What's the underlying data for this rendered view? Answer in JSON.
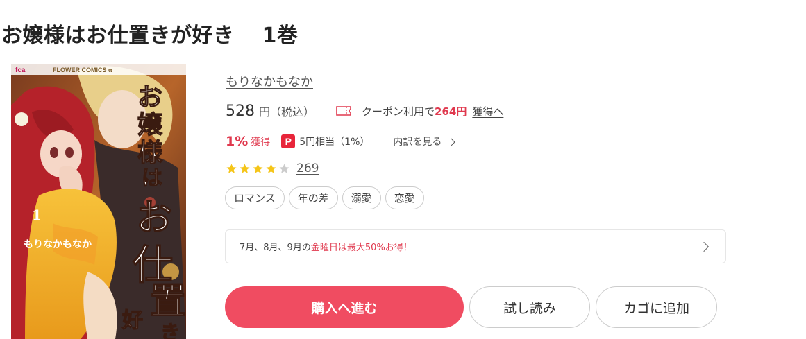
{
  "book": {
    "title": "お嬢様はお仕置きが好き",
    "volume": "1巻",
    "author": "もりなかもなか"
  },
  "cover": {
    "label_top": "FLOWER COMICS α",
    "label_logo": "fca",
    "title_art": "お嬢様はお仕置きが好き",
    "volume_mark": "1",
    "author_art": "もりなかもなか"
  },
  "price": {
    "amount": "528",
    "unit": "円",
    "tax_note": "（税込）",
    "coupon_prefix": "クーポン利用で",
    "coupon_amount": "264円",
    "coupon_link": "獲得へ"
  },
  "points": {
    "percent": "1%",
    "earn_label": "獲得",
    "paypay_icon": "P",
    "equivalent": "5円相当（1%）",
    "breakdown_link": "内訳を見る"
  },
  "rating": {
    "stars": 4,
    "max_stars": 5,
    "review_count": "269",
    "star_color": "#f5c518",
    "star_empty_color": "#cccccc"
  },
  "tags": [
    "ロマンス",
    "年の差",
    "溺愛",
    "恋愛"
  ],
  "promo": {
    "prefix": "7月、8月、9月の",
    "highlight": "金曜日は最大50%お得！"
  },
  "buttons": {
    "buy": "購入へ進む",
    "trial": "試し読み",
    "cart": "カゴに追加"
  },
  "colors": {
    "accent": "#f04c61",
    "accent_text": "#e0394e"
  }
}
